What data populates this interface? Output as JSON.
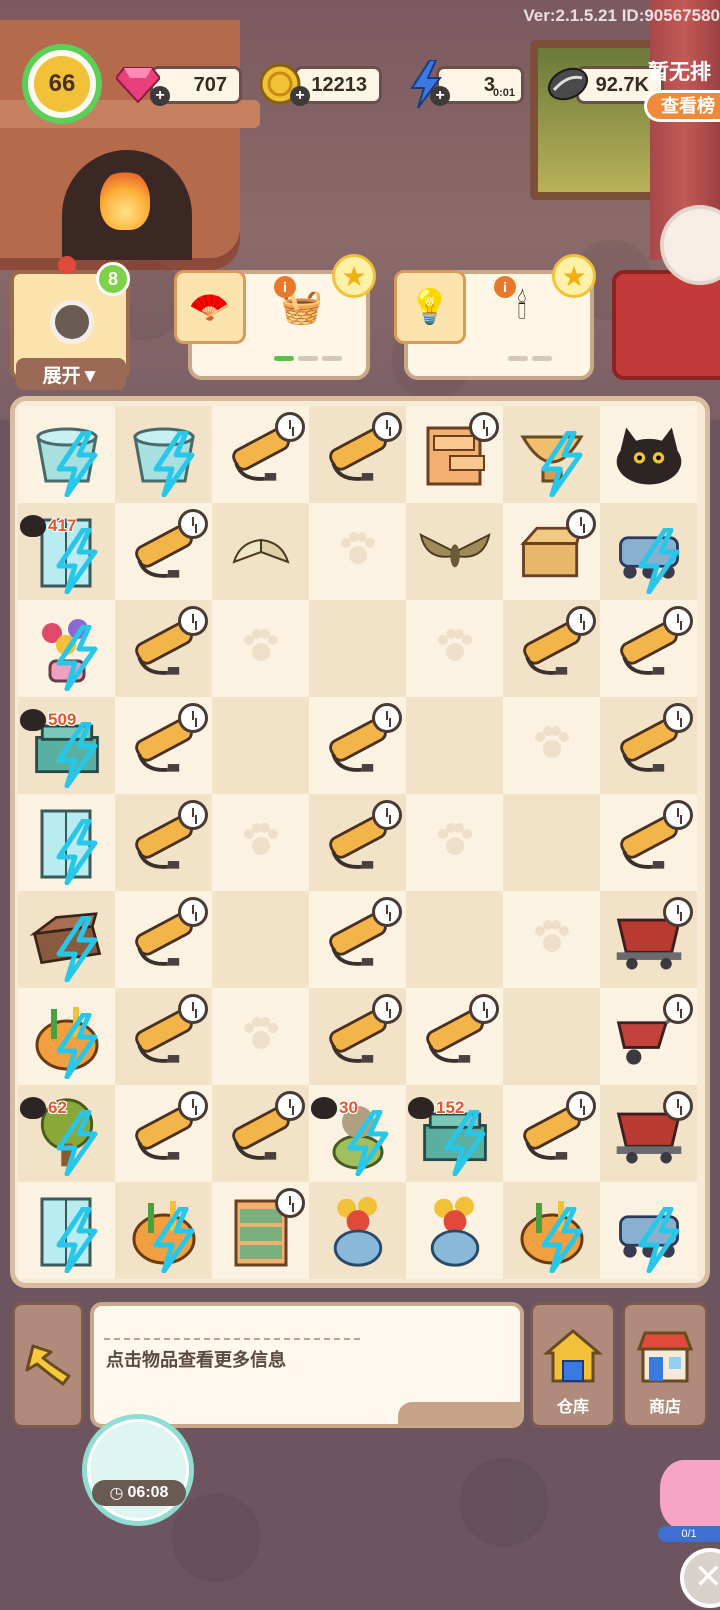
{
  "version_text": "Ver:2.1.5.21 ID:90567580",
  "hud": {
    "level": "66",
    "gems": "707",
    "coins": "12213",
    "energy": "3",
    "energy_timer": "0:01",
    "seeds": "92.7K"
  },
  "orders": {
    "expand_label": "展开▼",
    "expand_badge": "8",
    "cards": [
      {
        "items": [
          "folding-fan",
          "yarn-basket"
        ],
        "progress": [
          true,
          false,
          false
        ]
      },
      {
        "items": [
          "chandelier-small",
          "chandelier-large"
        ],
        "progress": [
          false,
          false,
          false
        ]
      }
    ],
    "event_title": "暂无排",
    "event_button": "查看榜"
  },
  "board": {
    "rows": [
      [
        {
          "item": "energy-bucket"
        },
        {
          "item": "energy-bucket"
        },
        {
          "item": "pipe",
          "timer": true
        },
        {
          "item": "pipe",
          "timer": true
        },
        {
          "item": "drawer-cabinet",
          "timer": true
        },
        {
          "item": "energy-bowl"
        },
        {
          "item": "black-cat"
        }
      ],
      [
        {
          "item": "energy-wardrobe",
          "cat_tag": "417"
        },
        {
          "item": "pipe",
          "timer": true
        },
        {
          "item": "moth-small"
        },
        {
          "empty": true
        },
        {
          "item": "moth"
        },
        {
          "item": "cardboard-box",
          "timer": true
        },
        {
          "item": "energy-robot"
        }
      ],
      [
        {
          "item": "energy-flowers"
        },
        {
          "item": "pipe",
          "timer": true
        },
        {
          "empty": true
        },
        {
          "empty": true
        },
        {
          "empty": true
        },
        {
          "item": "pipe",
          "timer": true
        },
        {
          "item": "pipe",
          "timer": true
        }
      ],
      [
        {
          "item": "energy-toolbox",
          "cat_tag": "509"
        },
        {
          "item": "pipe",
          "timer": true
        },
        {
          "empty": true
        },
        {
          "item": "pipe",
          "timer": true
        },
        {
          "empty": true
        },
        {
          "empty": true
        },
        {
          "item": "pipe",
          "timer": true
        }
      ],
      [
        {
          "item": "energy-wardrobe"
        },
        {
          "item": "pipe",
          "timer": true
        },
        {
          "empty": true
        },
        {
          "item": "pipe",
          "timer": true
        },
        {
          "empty": true
        },
        {
          "empty": true
        },
        {
          "item": "pipe",
          "timer": true
        }
      ],
      [
        {
          "item": "energy-suitcase"
        },
        {
          "item": "pipe",
          "timer": true
        },
        {
          "empty": true
        },
        {
          "item": "pipe",
          "timer": true
        },
        {
          "empty": true
        },
        {
          "empty": true
        },
        {
          "item": "mine-cart",
          "timer": true
        }
      ],
      [
        {
          "item": "energy-pot"
        },
        {
          "item": "pipe",
          "timer": true
        },
        {
          "empty": true
        },
        {
          "item": "pipe",
          "timer": true
        },
        {
          "item": "pipe",
          "timer": true
        },
        {
          "empty": true
        },
        {
          "item": "wheelbarrow",
          "timer": true
        }
      ],
      [
        {
          "item": "energy-tree",
          "cat_tag": "62"
        },
        {
          "item": "pipe",
          "timer": true
        },
        {
          "item": "pipe",
          "timer": true
        },
        {
          "item": "energy-pot-plant",
          "cat_tag": "30"
        },
        {
          "item": "energy-toolbox",
          "cat_tag": "152"
        },
        {
          "item": "pipe",
          "timer": true
        },
        {
          "item": "mine-cart",
          "timer": true
        }
      ],
      [
        {
          "item": "energy-wardrobe"
        },
        {
          "item": "energy-pot"
        },
        {
          "item": "dresser",
          "timer": true
        },
        {
          "item": "teapot-flowers"
        },
        {
          "item": "teapot-flowers"
        },
        {
          "item": "energy-pot"
        },
        {
          "item": "energy-robot"
        }
      ]
    ]
  },
  "bottom": {
    "info_text": "点击物品查看更多信息",
    "warehouse_label": "仓库",
    "shop_label": "商店",
    "timer_text": "06:08",
    "pig_progress": "0/1"
  },
  "colors": {
    "energy_bolt": "#28c6e8",
    "tile_light": "#fbf2e2",
    "tile_dark": "#f1e2c8",
    "cat_number": "#e8572a"
  }
}
